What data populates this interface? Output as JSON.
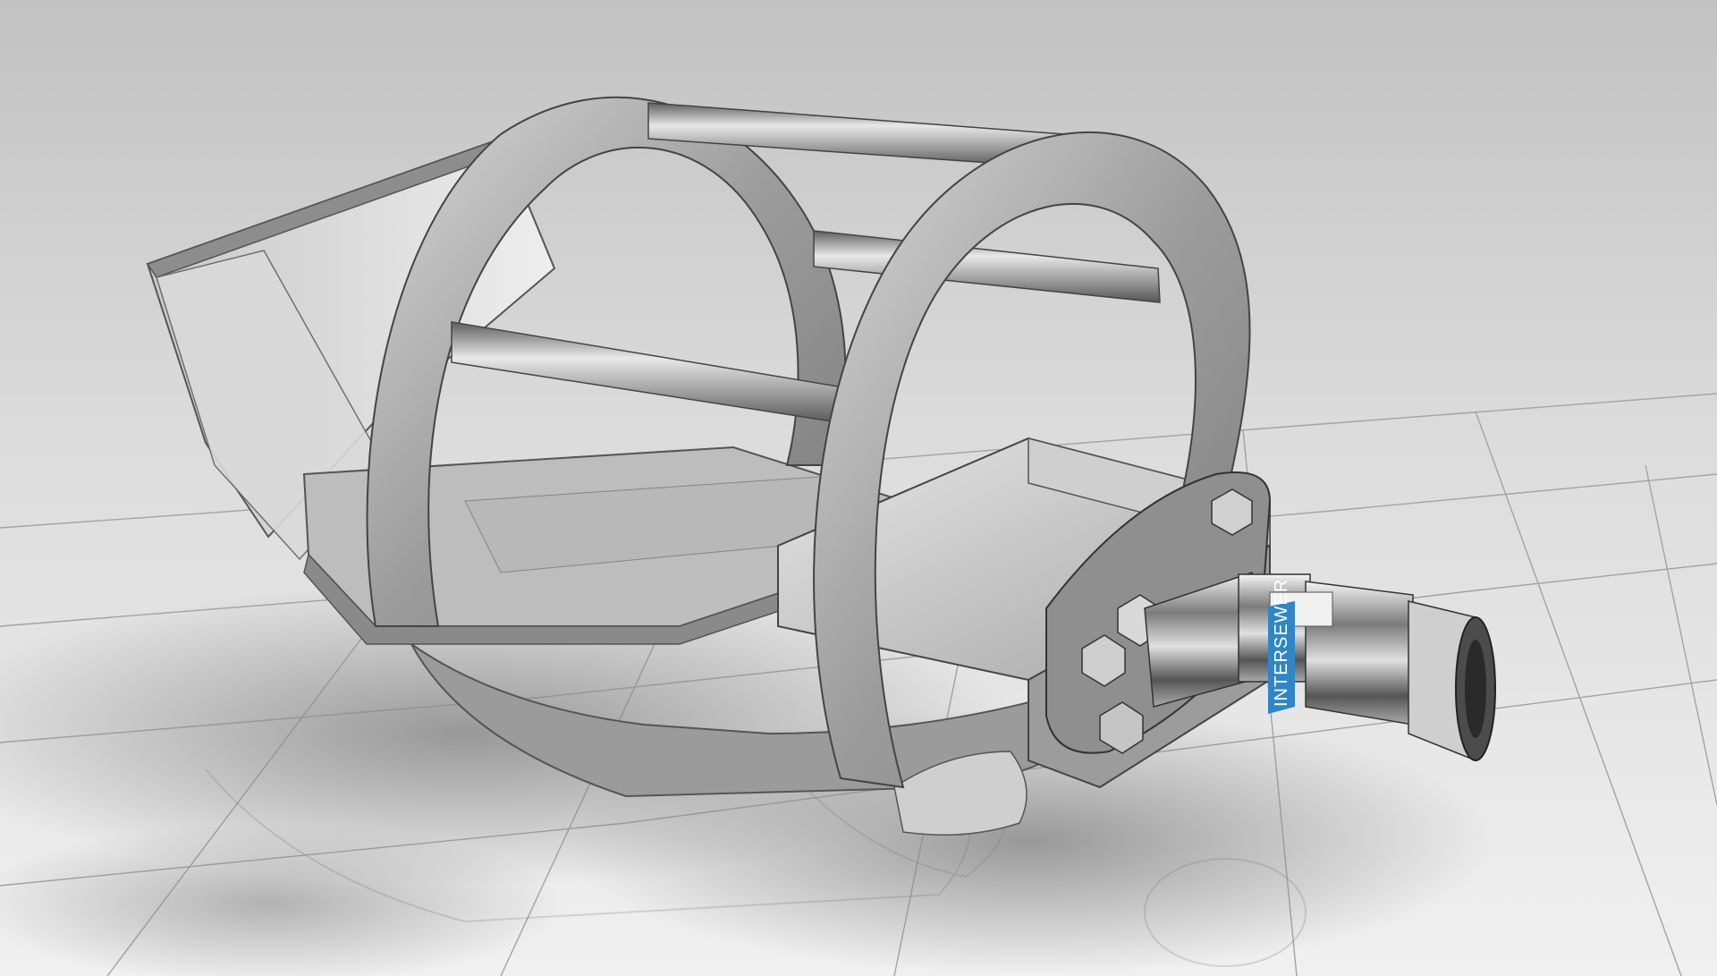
{
  "scene": {
    "description_free": true,
    "colors": {
      "background_top": "#c4c4c4",
      "background_bottom": "#f2f2f2",
      "floor": "#ededed",
      "grid_line": "#a9a9a9",
      "metal_light": "#e3e3e3",
      "metal_mid": "#a8a8a8",
      "metal_dark": "#6f6f6f",
      "edge": "#4a4a4a",
      "shadow": "#8c8c8c",
      "label_blue": "#2f86c6"
    },
    "label": {
      "brand_text": "INTERSEWER"
    }
  }
}
